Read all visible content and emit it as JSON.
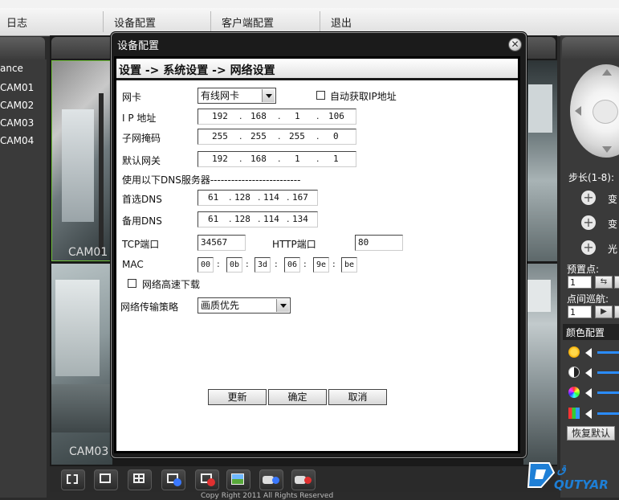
{
  "menu": {
    "items": [
      {
        "label": "日志"
      },
      {
        "label": "设备配置"
      },
      {
        "label": "客户端配置"
      },
      {
        "label": "退出"
      }
    ]
  },
  "left_panel": {
    "header_partial": "ance",
    "cameras": [
      "CAM01",
      "CAM02",
      "CAM03",
      "CAM04"
    ]
  },
  "video": {
    "cell_labels": [
      "CAM01",
      "CAM03"
    ]
  },
  "dialog": {
    "title": "设备配置",
    "close_glyph": "✕",
    "breadcrumb": "设置 -> 系统设置 -> 网络设置",
    "network_card": {
      "label": "网卡",
      "value": "有线网卡"
    },
    "auto_ip": {
      "label": "自动获取IP地址",
      "checked": false
    },
    "ip": {
      "label": "I P 地址",
      "octets": [
        "192",
        "168",
        "1",
        "106"
      ]
    },
    "subnet": {
      "label": "子网掩码",
      "octets": [
        "255",
        "255",
        "255",
        "0"
      ]
    },
    "gateway": {
      "label": "默认网关",
      "octets": [
        "192",
        "168",
        "1",
        "1"
      ]
    },
    "dns_section": "使用以下DNS服务器--------------------------",
    "primary_dns": {
      "label": "首选DNS",
      "octets": [
        "61",
        "128",
        "114",
        "167"
      ]
    },
    "secondary_dns": {
      "label": "备用DNS",
      "octets": [
        "61",
        "128",
        "114",
        "134"
      ]
    },
    "tcp_port": {
      "label": "TCP端口",
      "value": "34567"
    },
    "http_port": {
      "label": "HTTP端口",
      "value": "80"
    },
    "mac": {
      "label": "MAC",
      "parts": [
        "00",
        "0b",
        "3d",
        "06",
        "9e",
        "be"
      ]
    },
    "high_speed": {
      "label": "网络高速下载",
      "checked": false
    },
    "transfer_policy": {
      "label": "网络传输策略",
      "value": "画质优先"
    },
    "buttons": {
      "refresh": "更新",
      "ok": "确定",
      "cancel": "取消"
    }
  },
  "right_panel": {
    "step_label": "步长(1-8):",
    "zoom_label": "变",
    "focus_label": "变",
    "iris_label": "光",
    "preset_label": "预置点:",
    "preset_value": "1",
    "cruise_label": "点间巡航:",
    "cruise_value": "1",
    "color_tab": "颜色配置",
    "restore_button": "恢复默认"
  },
  "copyright": "Copy Right 2011 All Rights Reserved",
  "logo_text": "QUTYAR",
  "colors": {
    "slider_blue": "#2a8cff",
    "dialog_bg": "#1b1b1b",
    "panel_bg": "#3a3a3a"
  }
}
